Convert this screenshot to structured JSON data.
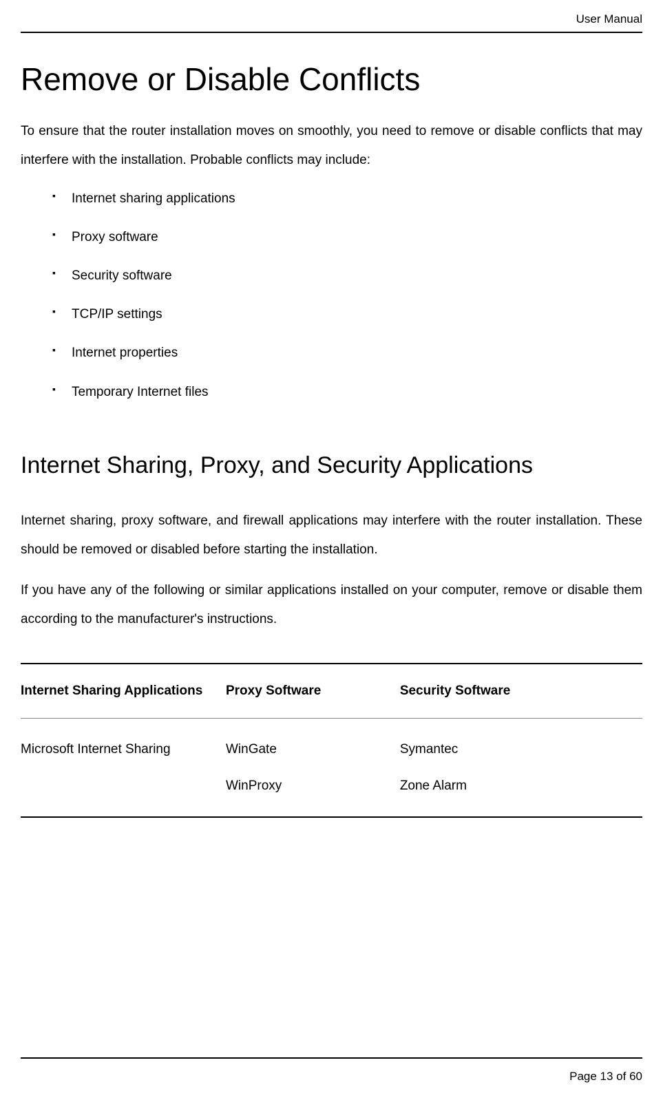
{
  "header": {
    "title": "User Manual"
  },
  "section1": {
    "heading": "Remove or Disable Conflicts",
    "intro": "To ensure that the router installation moves on smoothly, you need to remove or disable conflicts that may interfere with the installation. Probable conflicts may include:",
    "bullets": {
      "item0": "Internet sharing applications",
      "item1": "Proxy software",
      "item2": "Security software",
      "item3": "TCP/IP settings",
      "item4": "Internet properties",
      "item5": "Temporary Internet files"
    }
  },
  "section2": {
    "heading": "Internet Sharing, Proxy, and Security Applications",
    "para1": "Internet sharing, proxy software, and firewall applications may interfere with the router installation. These should be removed or disabled before starting the installation.",
    "para2": "If you have any of the following or similar applications installed on your computer, remove or disable them according to the manufacturer's instructions."
  },
  "table": {
    "headers": {
      "col1": "Internet Sharing Applications",
      "col2": "Proxy Software",
      "col3": "Security Software"
    },
    "row1": {
      "col1": "Microsoft Internet Sharing",
      "col2line1": "WinGate",
      "col2line2": "WinProxy",
      "col3line1": "Symantec",
      "col3line2": "Zone Alarm"
    }
  },
  "footer": {
    "pageinfo": "Page 13 of 60"
  }
}
